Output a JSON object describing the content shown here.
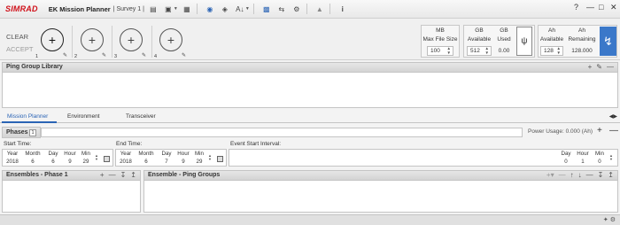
{
  "titlebar": {
    "brand": "SIMRAD",
    "app_title": "EK Mission Planner",
    "survey": "| Survey 1 |",
    "help": "?",
    "minimize": "—",
    "maximize": "□",
    "close": "✕"
  },
  "toolbar": {
    "clear_label": "CLEAR",
    "accept_label": "ACCEPT",
    "phases": [
      {
        "num": "1"
      },
      {
        "num": "2"
      },
      {
        "num": "3"
      },
      {
        "num": "4"
      }
    ],
    "mb": {
      "unit": "MB",
      "label": "Max File Size",
      "value": "100"
    },
    "gb_avail": {
      "unit": "GB",
      "label": "Available",
      "value": "512"
    },
    "gb_used": {
      "unit": "GB",
      "label": "Used",
      "value": "0.00"
    },
    "ah_avail": {
      "unit": "Ah",
      "label": "Available",
      "value": "128"
    },
    "ah_remaining": {
      "unit": "Ah",
      "label": "Remaining",
      "value": "128.000"
    }
  },
  "ping_group_library": {
    "title": "Ping Group Library"
  },
  "tabs": [
    {
      "label": "Mission Planner"
    },
    {
      "label": "Environment"
    },
    {
      "label": "Transceiver"
    }
  ],
  "phases": {
    "label": "Phases",
    "count": "1",
    "power_usage": "Power Usage: 0.000 (Ah)"
  },
  "start_time": {
    "label": "Start Time:",
    "cols": [
      "Year",
      "Month",
      "Day",
      "Hour",
      "Min"
    ],
    "values": [
      "2018",
      "6",
      "6",
      "9",
      "29"
    ]
  },
  "end_time": {
    "label": "End Time:",
    "cols": [
      "Year",
      "Month",
      "Day",
      "Hour",
      "Min"
    ],
    "values": [
      "2018",
      "6",
      "7",
      "9",
      "29"
    ]
  },
  "event_interval": {
    "label": "Event Start Interval:",
    "cols": [
      "Day",
      "Hour",
      "Min"
    ],
    "values": [
      "0",
      "1",
      "0"
    ]
  },
  "ensembles": {
    "title": "Ensembles - Phase 1"
  },
  "ensemble_ping_groups": {
    "title": "Ensemble - Ping Groups"
  }
}
